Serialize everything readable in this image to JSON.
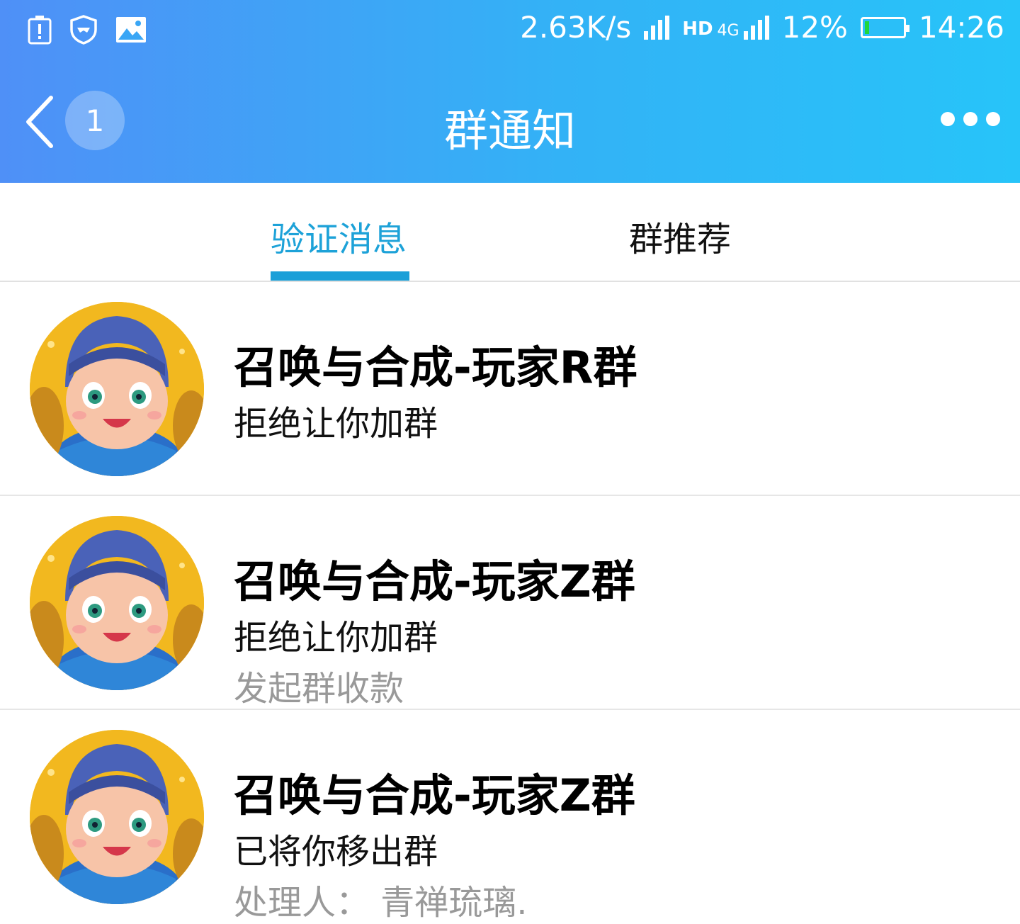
{
  "status_bar": {
    "left_icons": [
      "battery-alert-icon",
      "shield-icon",
      "image-icon"
    ],
    "net_speed": "2.63K/s",
    "hd": "HD",
    "network": "4G",
    "battery_pct": "12%",
    "battery_level": 0.12,
    "time": "14:26"
  },
  "nav": {
    "back_icon": "chevron-left-icon",
    "unread_badge": "1",
    "title": "群通知",
    "more_icon": "more-dots-icon"
  },
  "tabs": [
    {
      "label": "验证消息",
      "active": true
    },
    {
      "label": "群推荐",
      "active": false
    }
  ],
  "notifications": [
    {
      "group_name": "召唤与合成-玩家R群",
      "message": "拒绝让你加群",
      "detail": ""
    },
    {
      "group_name": "召唤与合成-玩家Z群",
      "message": "拒绝让你加群",
      "detail": "发起群收款"
    },
    {
      "group_name": "召唤与合成-玩家Z群",
      "message": "已将你移出群",
      "detail": "处理人：  青禅琉璃."
    }
  ],
  "colors": {
    "header_start": "#4f90f7",
    "header_end": "#27c4f9",
    "tab_active": "#1da2d8",
    "secondary_text": "#999999",
    "battery_fill": "#21d63a"
  }
}
